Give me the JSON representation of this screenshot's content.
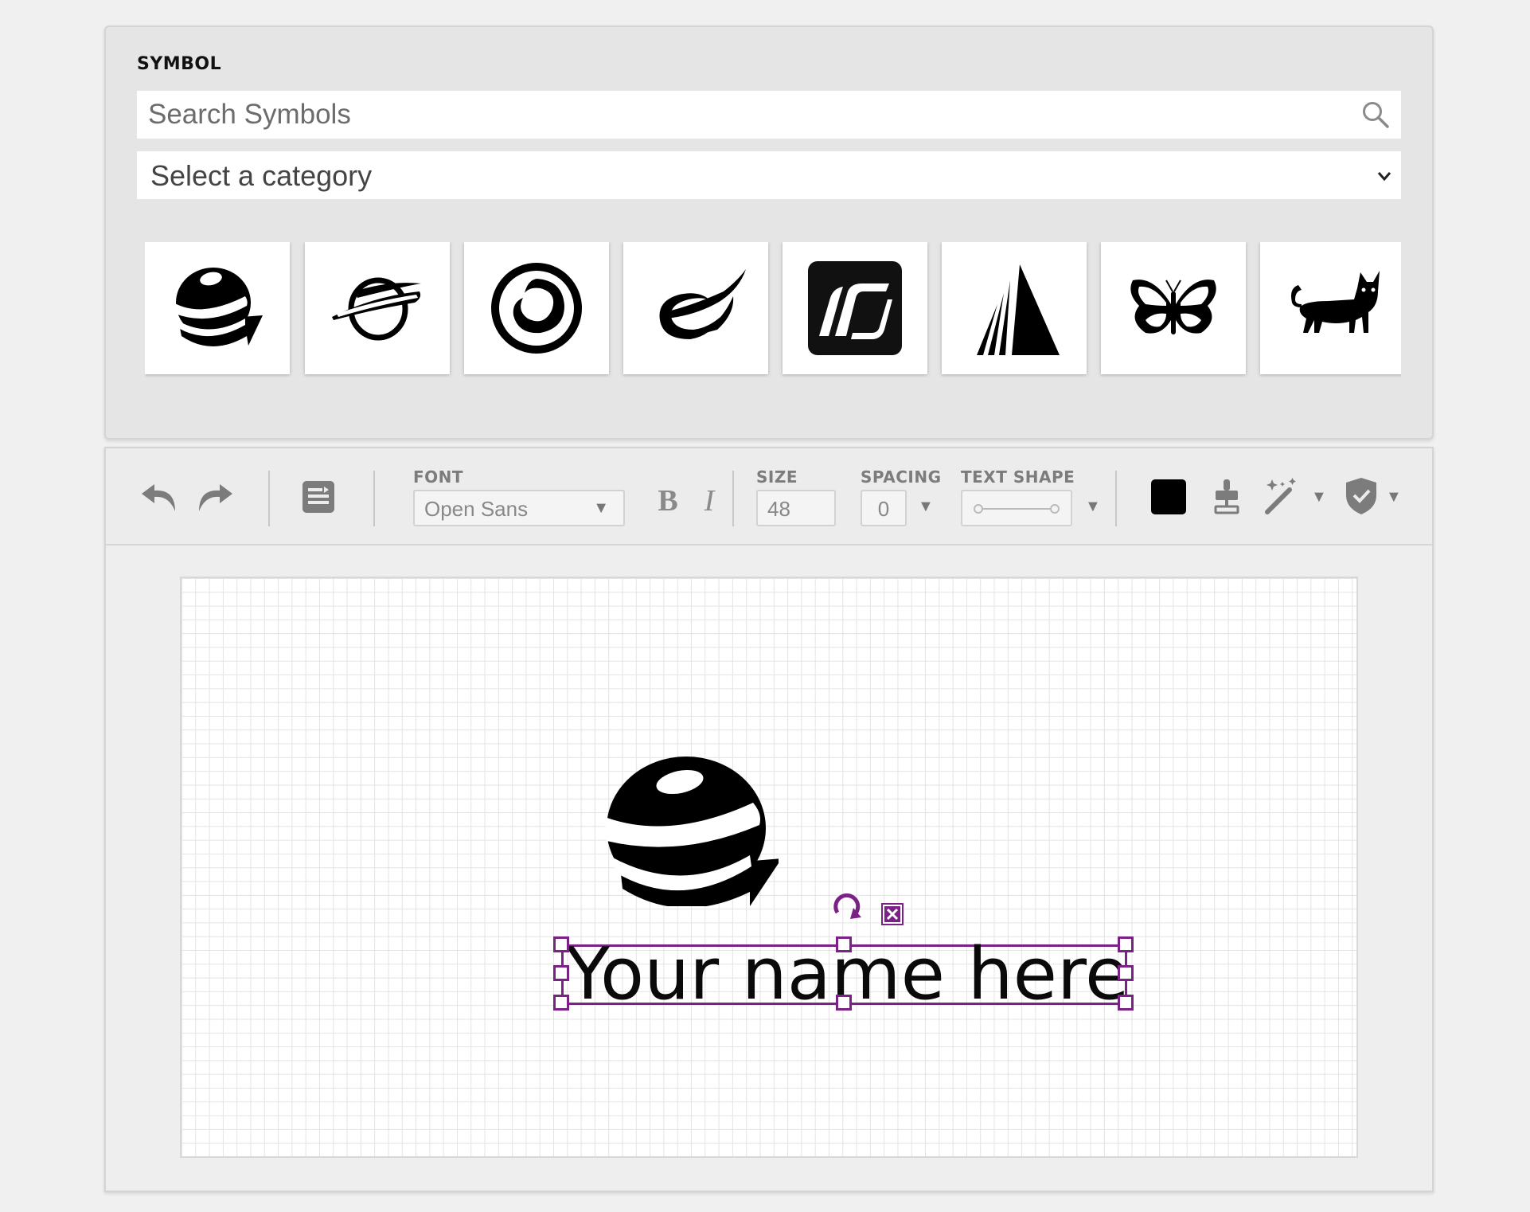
{
  "symbol_panel": {
    "heading": "SYMBOL",
    "search_placeholder": "Search Symbols",
    "category_selected": "Select a category",
    "symbols": [
      "globe-arrow-icon",
      "planet-swoosh-icon",
      "swirl-circle-icon",
      "orbit-swoosh-icon",
      "square-s-icon",
      "triangle-stripes-icon",
      "butterfly-icon",
      "cat-icon"
    ]
  },
  "toolbar": {
    "font_label": "FONT",
    "font_value": "Open Sans",
    "bold_label": "B",
    "italic_label": "I",
    "size_label": "SIZE",
    "size_value": "48",
    "spacing_label": "SPACING",
    "spacing_value": "0",
    "text_shape_label": "TEXT SHAPE",
    "color": "#000000",
    "selection_color": "#7b2286"
  },
  "canvas": {
    "text": "Your name here",
    "symbol": "globe-arrow-icon"
  }
}
